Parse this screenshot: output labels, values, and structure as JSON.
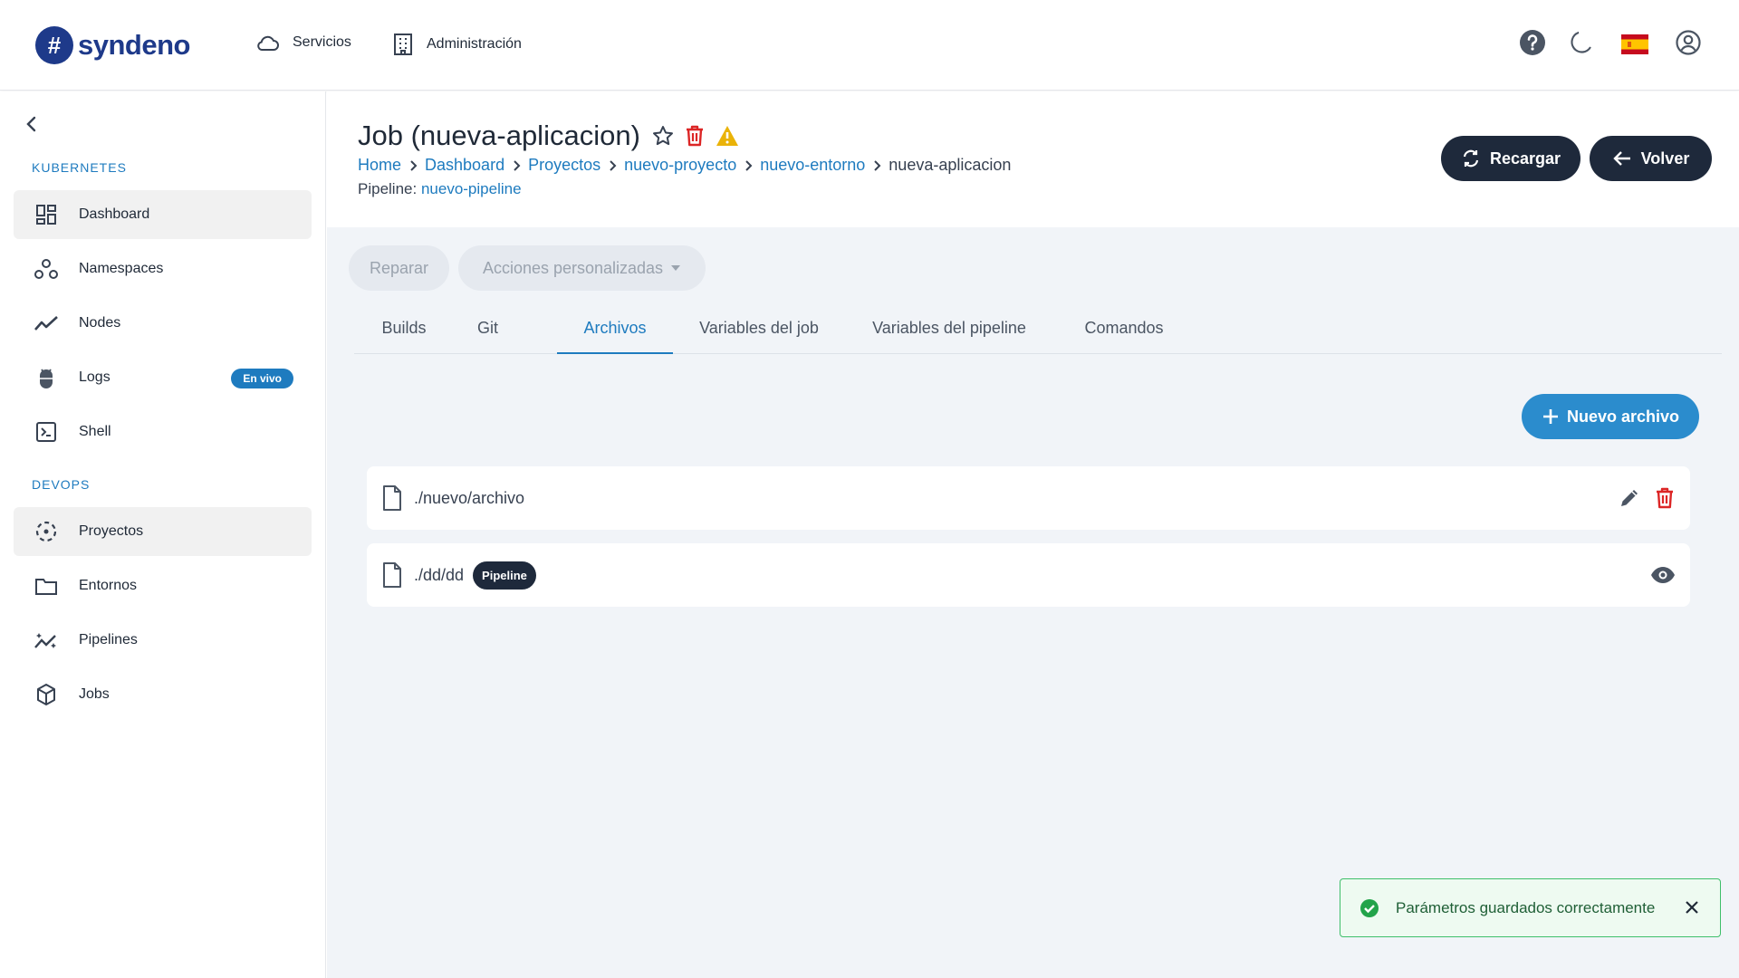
{
  "brand": {
    "symbol": "#",
    "name": "syndeno"
  },
  "topnav": {
    "services": "Servicios",
    "admin": "Administración"
  },
  "sidebar": {
    "kubernetes_label": "KUBERNETES",
    "devops_label": "DEVOPS",
    "items": [
      {
        "label": "Dashboard"
      },
      {
        "label": "Namespaces"
      },
      {
        "label": "Nodes"
      },
      {
        "label": "Logs",
        "badge": "En vivo"
      },
      {
        "label": "Shell"
      },
      {
        "label": "Proyectos"
      },
      {
        "label": "Entornos"
      },
      {
        "label": "Pipelines"
      },
      {
        "label": "Jobs"
      }
    ]
  },
  "header": {
    "title": "Job (nueva-aplicacion)",
    "breadcrumb": [
      "Home",
      "Dashboard",
      "Proyectos",
      "nuevo-proyecto",
      "nuevo-entorno",
      "nueva-aplicacion"
    ],
    "pipeline_label": "Pipeline:",
    "pipeline_name": "nuevo-pipeline",
    "reload_label": "Recargar",
    "back_label": "Volver"
  },
  "actions": {
    "repair": "Reparar",
    "custom": "Acciones personalizadas"
  },
  "tabs": [
    {
      "label": "Builds"
    },
    {
      "label": "Git"
    },
    {
      "label": "Archivos",
      "active": true
    },
    {
      "label": "Variables del job"
    },
    {
      "label": "Variables del pipeline"
    },
    {
      "label": "Comandos"
    }
  ],
  "new_file_label": "Nuevo archivo",
  "files": [
    {
      "path": "./nuevo/archivo"
    },
    {
      "path": "./dd/dd",
      "badge": "Pipeline"
    }
  ],
  "toast": {
    "message": "Parámetros guardados correctamente"
  },
  "colors": {
    "brand": "#1e3a8a",
    "accent": "#1e7bbf",
    "dark": "#1e293b",
    "danger": "#dc2626",
    "warning": "#eab308",
    "success": "#22a34a"
  }
}
